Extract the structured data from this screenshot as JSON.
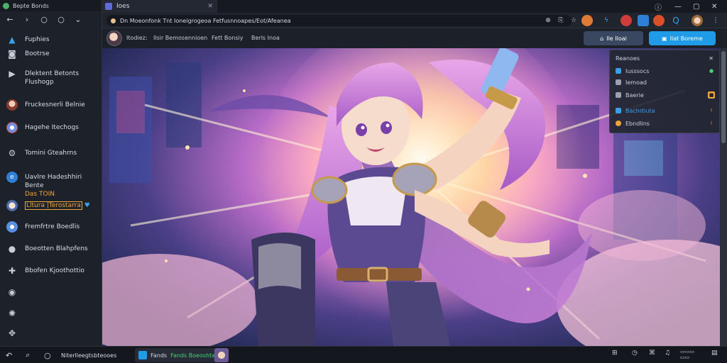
{
  "window": {
    "title": "Bepte Bonds"
  },
  "sidebar": {
    "nav": [
      "←",
      "›",
      "○",
      "○",
      "⌄"
    ],
    "items": [
      {
        "label": "Fuphies",
        "icon": "home-icon",
        "color": "#3aa0e6"
      },
      {
        "label": "Bootrse",
        "icon": "gamepad-icon",
        "color": "#c7ccd6"
      },
      {
        "label": "Dlektent Betonts Flushogp",
        "icon": "play-icon",
        "color": "#c7ccd6"
      },
      {
        "label": "Fruckesnerli Belnie",
        "icon": "profile-avatar-icon",
        "color": "#c0604a"
      },
      {
        "label": "Hagehe Itechogs",
        "icon": "chrome-icon",
        "color": "#6f8fe0"
      },
      {
        "label": "Tomini Gteahrns",
        "icon": "settings-icon",
        "color": "#c7ccd6"
      },
      {
        "label": "Uavlre Hadeshhiri Bente",
        "sub1": "Das TOIN",
        "sub2": "Lltura |Terostarra",
        "icon": "edge-icon",
        "color": "#2f7fd6"
      },
      {
        "label": "Fremfrtre Boedlis",
        "icon": "chrome-icon",
        "color": "#5a8fe0"
      },
      {
        "label": "Boeotten Blahpfens",
        "icon": "chat-icon",
        "color": "#c7ccd6"
      },
      {
        "label": "Bbofen Kjoothottio",
        "icon": "puzzle-icon",
        "color": "#c7ccd6"
      },
      {
        "label": "",
        "icon": "circle-icon",
        "color": "#c7ccd6"
      },
      {
        "label": "",
        "icon": "globe-icon",
        "color": "#c7ccd6"
      },
      {
        "label": "",
        "icon": "gamepad-small-icon",
        "color": "#c7ccd6"
      }
    ]
  },
  "tab": {
    "title": "Ioes"
  },
  "address": {
    "url": "Dn  Moeonfonk Tnt Ioneigrogeoa   Fetfusnnoapes/Eot/Afeanea"
  },
  "subbar": {
    "crumbs": [
      "Itodiez:",
      "Ilsir Bemosennioen",
      "Fett Bonsiy",
      "Berls Inoa"
    ],
    "btn_secondary": "Ile Iloai",
    "btn_primary": "Ilat Boreme"
  },
  "panel": {
    "title": "Reanoes",
    "rows": [
      {
        "label": "Iusssocs",
        "badge": ""
      },
      {
        "label": "Iemoad",
        "badge": ""
      },
      {
        "label": "Baerie",
        "badge": ""
      },
      {
        "label": "Bachrtiuta",
        "badge": ""
      },
      {
        "label": "Ebndlins",
        "badge": ""
      }
    ]
  },
  "taskbar": {
    "search": "Niterlleegtsbteooes",
    "app_label": "Fands Boeoshtarns",
    "colors": {
      "accent": "#1f9be8",
      "green": "#4cd07a"
    }
  }
}
